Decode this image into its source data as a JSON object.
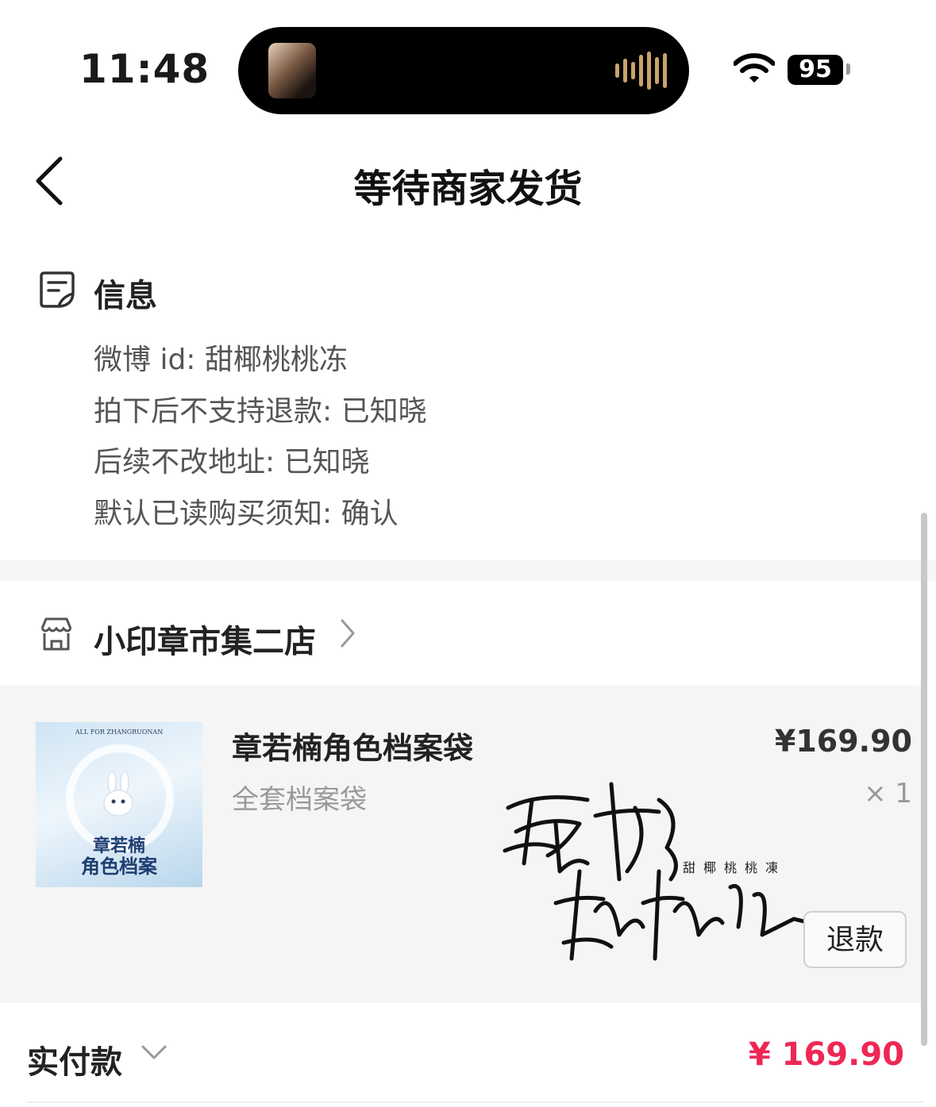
{
  "status_bar": {
    "time": "11:48",
    "battery": "95"
  },
  "nav": {
    "title": "等待商家发货"
  },
  "info": {
    "title": "信息",
    "lines": [
      "微博 id: 甜椰桃桃冻",
      "拍下后不支持退款: 已知晓",
      "后续不改地址: 已知晓",
      "默认已读购买须知: 确认"
    ]
  },
  "shop": {
    "name": "小印章市集二店"
  },
  "product": {
    "name": "章若楠角色档案袋",
    "spec": "全套档案袋",
    "price": "¥169.90",
    "quantity": "× 1",
    "thumb_header": "ALL FOR ZHANGRUONAN",
    "thumb_title_line1": "章若楠",
    "thumb_title_line2": "角色档案",
    "refund_label": "退款"
  },
  "watermark": {
    "small_text": "甜椰桃桃凍"
  },
  "payment": {
    "label": "实付款",
    "amount": "¥ 169.90"
  },
  "colors": {
    "price_red": "#ee2855",
    "background_gray": "#f5f5f5"
  }
}
